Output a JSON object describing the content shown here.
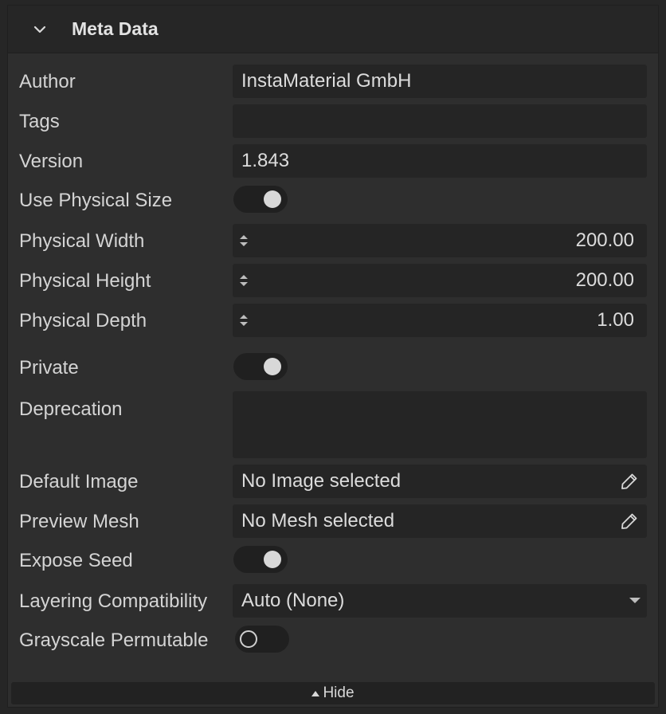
{
  "header": {
    "title": "Meta Data",
    "collapse_icon": "chevron-down-icon"
  },
  "rows": {
    "author": {
      "label": "Author",
      "value": "InstaMaterial GmbH"
    },
    "tags": {
      "label": "Tags",
      "value": ""
    },
    "version": {
      "label": "Version",
      "value": "1.843"
    },
    "use_physical_size": {
      "label": "Use Physical Size",
      "state": "on"
    },
    "physical_width": {
      "label": "Physical Width",
      "value": "200.00"
    },
    "physical_height": {
      "label": "Physical Height",
      "value": "200.00"
    },
    "physical_depth": {
      "label": "Physical Depth",
      "value": "1.00"
    },
    "private": {
      "label": "Private",
      "state": "on"
    },
    "deprecation": {
      "label": "Deprecation",
      "value": ""
    },
    "default_image": {
      "label": "Default Image",
      "value": "No Image selected"
    },
    "preview_mesh": {
      "label": "Preview Mesh",
      "value": "No Mesh selected"
    },
    "expose_seed": {
      "label": "Expose Seed",
      "state": "on"
    },
    "layering_compatibility": {
      "label": "Layering Compatibility",
      "value": "Auto (None)"
    },
    "grayscale_permutable": {
      "label": "Grayscale Permutable",
      "state": "off"
    }
  },
  "footer": {
    "hide_label": "Hide"
  },
  "colors": {
    "panel_bg": "#2e2e2e",
    "field_bg": "#252525",
    "text": "#d8d8d8"
  }
}
